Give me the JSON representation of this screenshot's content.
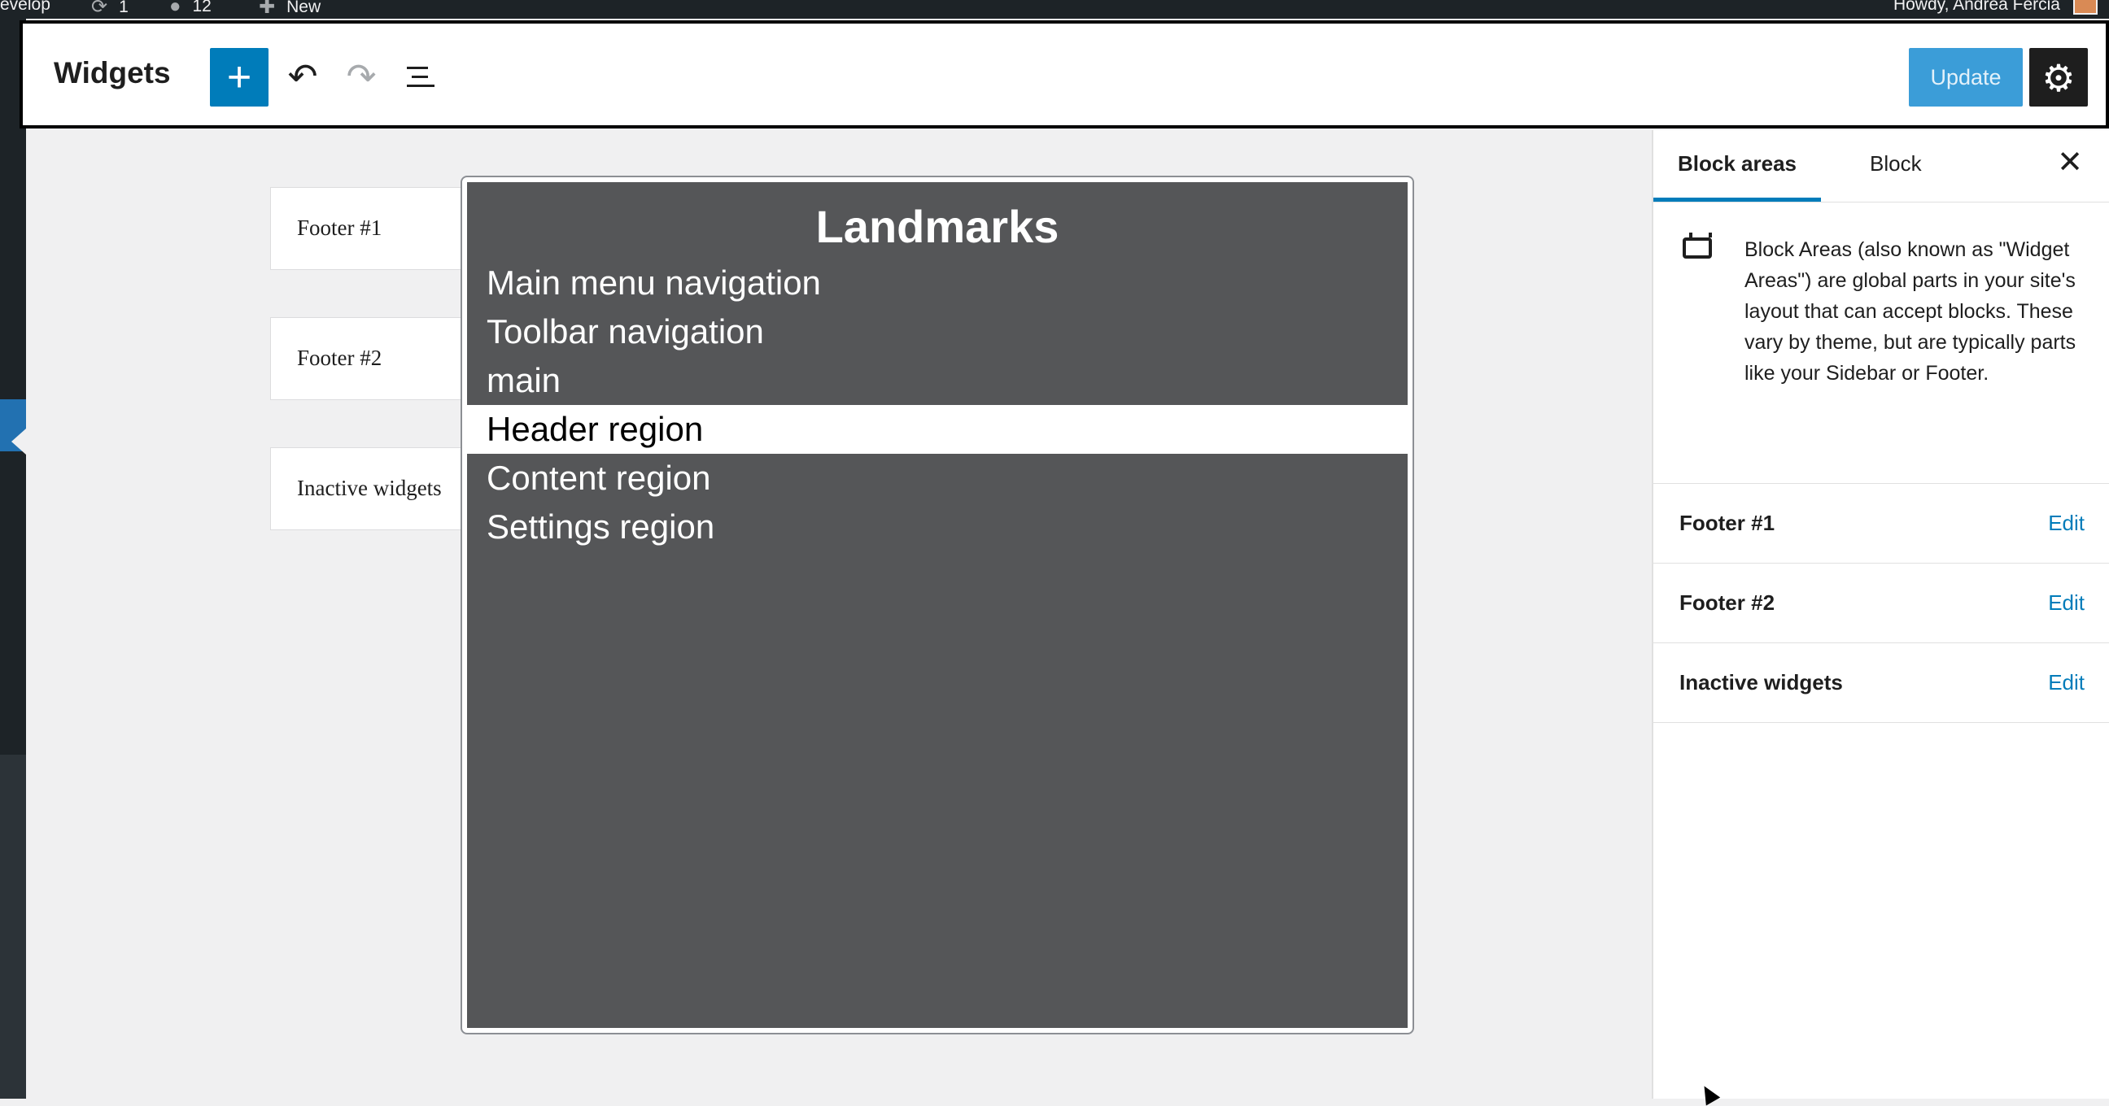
{
  "admin_bar": {
    "site_label": "evelop",
    "updates_count": "1",
    "comments_count": "12",
    "new_label": "New",
    "howdy": "Howdy, Andrea Fercia"
  },
  "header": {
    "title": "Widgets",
    "add_icon": "plus-icon",
    "undo_icon": "undo-icon",
    "redo_icon": "redo-icon",
    "list_view_icon": "list-view-icon",
    "update_label": "Update",
    "settings_icon": "gear-icon"
  },
  "canvas": {
    "areas": [
      "Footer #1",
      "Footer #2",
      "Inactive widgets"
    ]
  },
  "landmarks": {
    "title": "Landmarks",
    "items": [
      "Main menu navigation",
      "Toolbar navigation",
      "main",
      "Header region",
      "Content region",
      "Settings region"
    ],
    "selected_index": 3
  },
  "sidebar": {
    "tabs": [
      "Block areas",
      "Block"
    ],
    "active_tab": "Block areas",
    "close_icon": "close-icon",
    "description": "Block Areas (also known as \"Widget Areas\") are global parts in your site's layout that can accept blocks. These vary by theme, but are typically parts like your Sidebar or Footer.",
    "areas": [
      {
        "name": "Footer #1",
        "action": "Edit"
      },
      {
        "name": "Footer #2",
        "action": "Edit"
      },
      {
        "name": "Inactive widgets",
        "action": "Edit"
      }
    ]
  },
  "colors": {
    "accent": "#007cba",
    "admin_bar": "#1d2327",
    "overlay_bg": "#555658"
  }
}
